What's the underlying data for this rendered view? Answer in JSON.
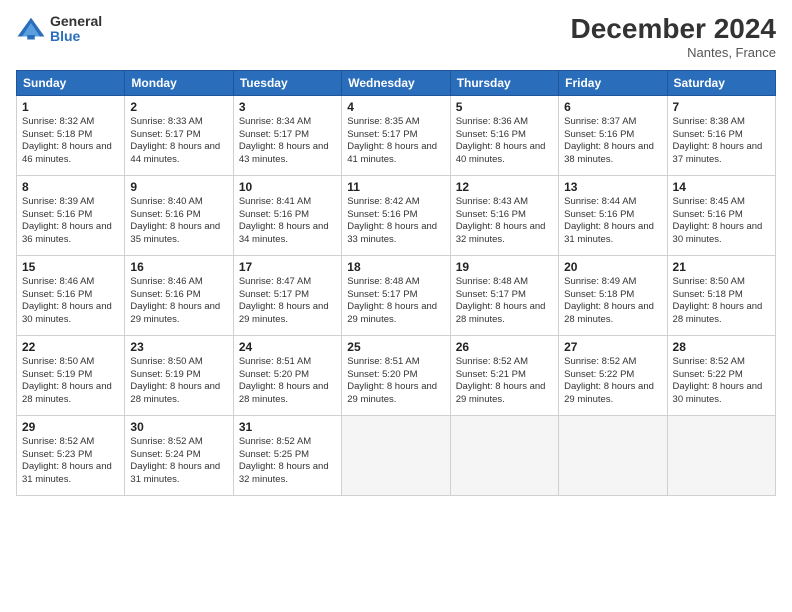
{
  "logo": {
    "general": "General",
    "blue": "Blue"
  },
  "header": {
    "month": "December 2024",
    "location": "Nantes, France"
  },
  "weekdays": [
    "Sunday",
    "Monday",
    "Tuesday",
    "Wednesday",
    "Thursday",
    "Friday",
    "Saturday"
  ],
  "weeks": [
    [
      {
        "day": "1",
        "sunrise": "Sunrise: 8:32 AM",
        "sunset": "Sunset: 5:18 PM",
        "daylight": "Daylight: 8 hours and 46 minutes."
      },
      {
        "day": "2",
        "sunrise": "Sunrise: 8:33 AM",
        "sunset": "Sunset: 5:17 PM",
        "daylight": "Daylight: 8 hours and 44 minutes."
      },
      {
        "day": "3",
        "sunrise": "Sunrise: 8:34 AM",
        "sunset": "Sunset: 5:17 PM",
        "daylight": "Daylight: 8 hours and 43 minutes."
      },
      {
        "day": "4",
        "sunrise": "Sunrise: 8:35 AM",
        "sunset": "Sunset: 5:17 PM",
        "daylight": "Daylight: 8 hours and 41 minutes."
      },
      {
        "day": "5",
        "sunrise": "Sunrise: 8:36 AM",
        "sunset": "Sunset: 5:16 PM",
        "daylight": "Daylight: 8 hours and 40 minutes."
      },
      {
        "day": "6",
        "sunrise": "Sunrise: 8:37 AM",
        "sunset": "Sunset: 5:16 PM",
        "daylight": "Daylight: 8 hours and 38 minutes."
      },
      {
        "day": "7",
        "sunrise": "Sunrise: 8:38 AM",
        "sunset": "Sunset: 5:16 PM",
        "daylight": "Daylight: 8 hours and 37 minutes."
      }
    ],
    [
      {
        "day": "8",
        "sunrise": "Sunrise: 8:39 AM",
        "sunset": "Sunset: 5:16 PM",
        "daylight": "Daylight: 8 hours and 36 minutes."
      },
      {
        "day": "9",
        "sunrise": "Sunrise: 8:40 AM",
        "sunset": "Sunset: 5:16 PM",
        "daylight": "Daylight: 8 hours and 35 minutes."
      },
      {
        "day": "10",
        "sunrise": "Sunrise: 8:41 AM",
        "sunset": "Sunset: 5:16 PM",
        "daylight": "Daylight: 8 hours and 34 minutes."
      },
      {
        "day": "11",
        "sunrise": "Sunrise: 8:42 AM",
        "sunset": "Sunset: 5:16 PM",
        "daylight": "Daylight: 8 hours and 33 minutes."
      },
      {
        "day": "12",
        "sunrise": "Sunrise: 8:43 AM",
        "sunset": "Sunset: 5:16 PM",
        "daylight": "Daylight: 8 hours and 32 minutes."
      },
      {
        "day": "13",
        "sunrise": "Sunrise: 8:44 AM",
        "sunset": "Sunset: 5:16 PM",
        "daylight": "Daylight: 8 hours and 31 minutes."
      },
      {
        "day": "14",
        "sunrise": "Sunrise: 8:45 AM",
        "sunset": "Sunset: 5:16 PM",
        "daylight": "Daylight: 8 hours and 30 minutes."
      }
    ],
    [
      {
        "day": "15",
        "sunrise": "Sunrise: 8:46 AM",
        "sunset": "Sunset: 5:16 PM",
        "daylight": "Daylight: 8 hours and 30 minutes."
      },
      {
        "day": "16",
        "sunrise": "Sunrise: 8:46 AM",
        "sunset": "Sunset: 5:16 PM",
        "daylight": "Daylight: 8 hours and 29 minutes."
      },
      {
        "day": "17",
        "sunrise": "Sunrise: 8:47 AM",
        "sunset": "Sunset: 5:17 PM",
        "daylight": "Daylight: 8 hours and 29 minutes."
      },
      {
        "day": "18",
        "sunrise": "Sunrise: 8:48 AM",
        "sunset": "Sunset: 5:17 PM",
        "daylight": "Daylight: 8 hours and 29 minutes."
      },
      {
        "day": "19",
        "sunrise": "Sunrise: 8:48 AM",
        "sunset": "Sunset: 5:17 PM",
        "daylight": "Daylight: 8 hours and 28 minutes."
      },
      {
        "day": "20",
        "sunrise": "Sunrise: 8:49 AM",
        "sunset": "Sunset: 5:18 PM",
        "daylight": "Daylight: 8 hours and 28 minutes."
      },
      {
        "day": "21",
        "sunrise": "Sunrise: 8:50 AM",
        "sunset": "Sunset: 5:18 PM",
        "daylight": "Daylight: 8 hours and 28 minutes."
      }
    ],
    [
      {
        "day": "22",
        "sunrise": "Sunrise: 8:50 AM",
        "sunset": "Sunset: 5:19 PM",
        "daylight": "Daylight: 8 hours and 28 minutes."
      },
      {
        "day": "23",
        "sunrise": "Sunrise: 8:50 AM",
        "sunset": "Sunset: 5:19 PM",
        "daylight": "Daylight: 8 hours and 28 minutes."
      },
      {
        "day": "24",
        "sunrise": "Sunrise: 8:51 AM",
        "sunset": "Sunset: 5:20 PM",
        "daylight": "Daylight: 8 hours and 28 minutes."
      },
      {
        "day": "25",
        "sunrise": "Sunrise: 8:51 AM",
        "sunset": "Sunset: 5:20 PM",
        "daylight": "Daylight: 8 hours and 29 minutes."
      },
      {
        "day": "26",
        "sunrise": "Sunrise: 8:52 AM",
        "sunset": "Sunset: 5:21 PM",
        "daylight": "Daylight: 8 hours and 29 minutes."
      },
      {
        "day": "27",
        "sunrise": "Sunrise: 8:52 AM",
        "sunset": "Sunset: 5:22 PM",
        "daylight": "Daylight: 8 hours and 29 minutes."
      },
      {
        "day": "28",
        "sunrise": "Sunrise: 8:52 AM",
        "sunset": "Sunset: 5:22 PM",
        "daylight": "Daylight: 8 hours and 30 minutes."
      }
    ],
    [
      {
        "day": "29",
        "sunrise": "Sunrise: 8:52 AM",
        "sunset": "Sunset: 5:23 PM",
        "daylight": "Daylight: 8 hours and 31 minutes."
      },
      {
        "day": "30",
        "sunrise": "Sunrise: 8:52 AM",
        "sunset": "Sunset: 5:24 PM",
        "daylight": "Daylight: 8 hours and 31 minutes."
      },
      {
        "day": "31",
        "sunrise": "Sunrise: 8:52 AM",
        "sunset": "Sunset: 5:25 PM",
        "daylight": "Daylight: 8 hours and 32 minutes."
      },
      null,
      null,
      null,
      null
    ]
  ]
}
